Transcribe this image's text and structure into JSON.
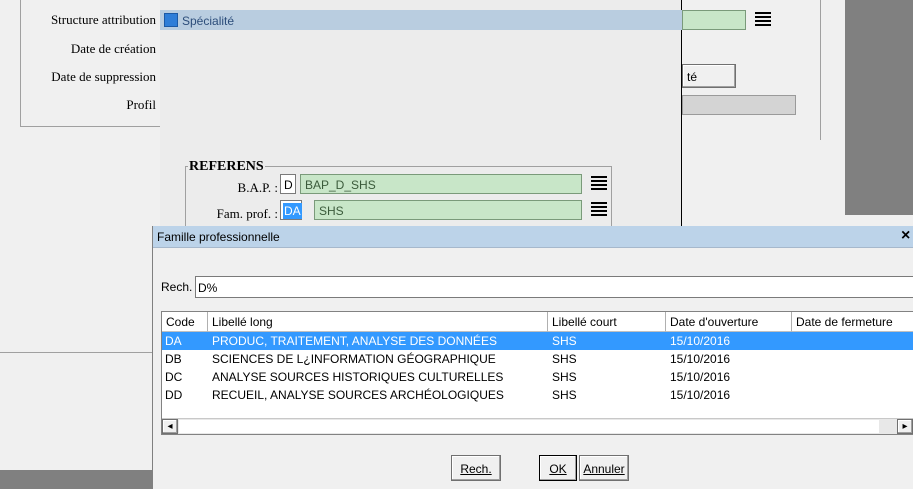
{
  "form": {
    "labels": {
      "structure": "Structure attribution",
      "date_creation": "Date de création",
      "date_suppression": "Date de suppression",
      "profil": "Profil"
    },
    "popup_item": "Spécialité",
    "partial_button": "té"
  },
  "referens": {
    "title": "REFERENS",
    "bap_label": "B.A.P. :",
    "bap_code": "D",
    "bap_value": "BAP_D_SHS",
    "fam_label": "Fam. prof. :",
    "fam_code": "DA",
    "fam_value": "SHS"
  },
  "dialog": {
    "title": "Famille professionnelle",
    "close": "×",
    "search_label": "Rech.",
    "search_value": "D%",
    "columns": [
      "Code",
      "Libellé long",
      "Libellé court",
      "Date d'ouverture",
      "Date de fermeture"
    ],
    "rows": [
      {
        "code": "DA",
        "long": "PRODUC, TRAITEMENT, ANALYSE DES DONNÉES",
        "short": "SHS",
        "open": "15/10/2016",
        "close": "",
        "selected": true
      },
      {
        "code": "DB",
        "long": "SCIENCES DE L¿INFORMATION GÉOGRAPHIQUE",
        "short": "SHS",
        "open": "15/10/2016",
        "close": "",
        "selected": false
      },
      {
        "code": "DC",
        "long": "ANALYSE SOURCES HISTORIQUES CULTURELLES",
        "short": "SHS",
        "open": "15/10/2016",
        "close": "",
        "selected": false
      },
      {
        "code": "DD",
        "long": "RECUEIL, ANALYSE SOURCES ARCHÉOLOGIQUES",
        "short": "SHS",
        "open": "15/10/2016",
        "close": "",
        "selected": false
      }
    ],
    "buttons": {
      "rech": "Rech.",
      "ok": "OK",
      "annuler": "Annuler"
    },
    "scroll_left": "◂",
    "scroll_right": "▸"
  }
}
